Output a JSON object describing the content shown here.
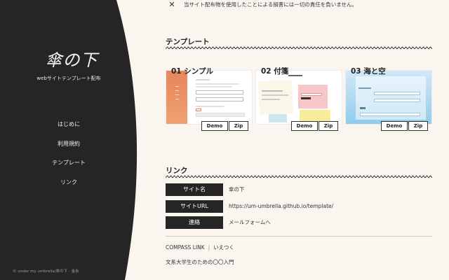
{
  "notice": {
    "text": "当サイト配布物を使用したことによる損害には一切の責任を負いません。"
  },
  "sidebar": {
    "logo": "傘の下",
    "subtitle": "webサイトテンプレート配布",
    "items": [
      {
        "label": "はじめに"
      },
      {
        "label": "利用規約"
      },
      {
        "label": "テンプレート"
      },
      {
        "label": "リンク"
      }
    ],
    "copyright": "© under my umbrella/傘の下 - 金糸"
  },
  "templates": {
    "heading": "テンプレート",
    "cards": [
      {
        "title": "01 シンプル",
        "demo": "Demo",
        "zip": "Zip"
      },
      {
        "title": "02 付箋",
        "demo": "Demo",
        "zip": "Zip"
      },
      {
        "title": "03 海と空",
        "demo": "Demo",
        "zip": "Zip"
      }
    ]
  },
  "links": {
    "heading": "リンク",
    "rows": [
      {
        "label": "サイト名",
        "value": "傘の下"
      },
      {
        "label": "サイトURL",
        "value": "https://um-umbrella.github.io/template/"
      },
      {
        "label": "連絡",
        "value": "メールフォームへ"
      }
    ],
    "extra_links": [
      "COMPASS LINK",
      "いえつく"
    ],
    "extra_link2": "文系大学生のための〇〇入門"
  },
  "colors": {
    "sidebar": "#252525",
    "background": "#fbf5ef",
    "accent_orange": "#e7855a",
    "accent_sky": "#8ecbed"
  }
}
